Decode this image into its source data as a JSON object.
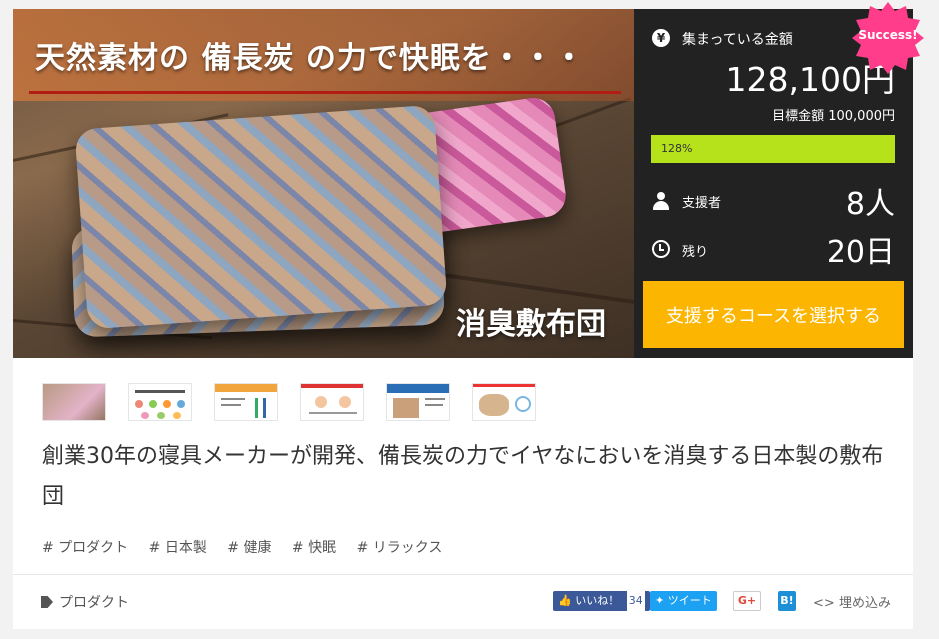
{
  "hero": {
    "headline": "天然素材の 備長炭 の力で快眠を・・・",
    "subtitle": "消臭敷布団"
  },
  "stats": {
    "collected_label": "集まっている金額",
    "collected_amount": "128,100円",
    "goal": "目標金額 100,000円",
    "progress_text": "128%",
    "progress_value": 1.0,
    "supporters_label": "支援者",
    "supporters_value": "8人",
    "remaining_label": "残り",
    "remaining_value": "20日",
    "cta_label": "支援するコースを選択する",
    "badge": "Success!",
    "yen_symbol": "¥"
  },
  "project": {
    "title": "創業30年の寝具メーカーが開発、備長炭の力でイヤなにおいを消臭する日本製の敷布団",
    "tags": [
      "# プロダクト",
      "# 日本製",
      "# 健康",
      "# 快眠",
      "# リラックス"
    ]
  },
  "footer": {
    "category": "プロダクト",
    "like_label": "いいね！",
    "like_count": "34",
    "tweet_label": "ツイート",
    "gplus_label": "G+",
    "hatena_label": "B!",
    "embed_label": "埋め込み",
    "embed_symbol": "<>"
  },
  "colors": {
    "accent_progress": "#b5e21a",
    "cta": "#fcb500",
    "badge": "#ff3d8b",
    "panel": "#222222"
  }
}
